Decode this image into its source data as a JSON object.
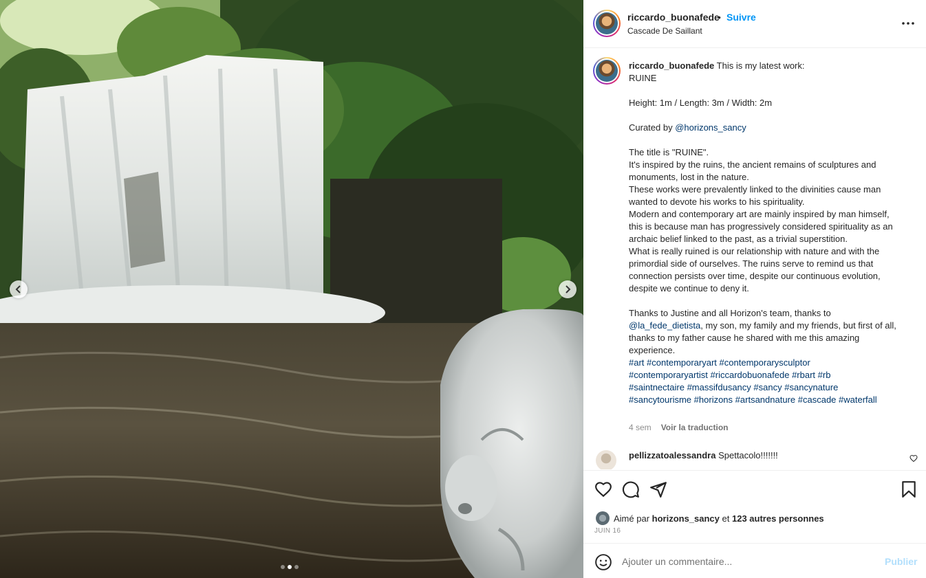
{
  "post": {
    "username": "riccardo_buonafede",
    "separator": "•",
    "follow_label": "Suivre",
    "location": "Cascade De Saillant"
  },
  "caption": {
    "username": "riccardo_buonafede",
    "p1": " This is my latest work:\nRUINE\n\nHeight: 1m / Length: 3m / Width: 2m\n\nCurated by ",
    "mention1": "@horizons_sancy",
    "p2": "\n\nThe title is \"RUINE\".\nIt's inspired by the ruins, the ancient remains of sculptures and monuments, lost in the nature.\nThese works were prevalently linked to the divinities cause man wanted to devote his works to his spirituality.\nModern and contemporary art are mainly inspired by man himself, this is because man has progressively considered spirituality as an archaic belief linked to the past, as a trivial superstition.\nWhat is really ruined is our relationship with nature and with the primordial side of ourselves. The ruins serve to remind us that connection persists over time, despite our continuous evolution, despite we continue to deny it.\n\nThanks to Justine and all Horizon's team, thanks to\n",
    "mention2": "@la_fede_dietista",
    "p3": ", my son, my family and my friends, but first of all, thanks to my father cause he shared with me this amazing experience.\n",
    "hashtags": [
      "#art",
      "#contemporaryart",
      "#contemporarysculptor",
      "#contemporaryartist",
      "#riccardobuonafede",
      "#rbart",
      "#rb",
      "#saintnectaire",
      "#massifdusancy",
      "#sancy",
      "#sancynature",
      "#sancytourisme",
      "#horizons",
      "#artsandnature",
      "#cascade",
      "#waterfall"
    ],
    "time_ago": "4 sem",
    "translate_label": "Voir la traduction"
  },
  "comment": {
    "username": "pellizzatoalessandra",
    "text": "Spettacolo!!!!!!!"
  },
  "likes": {
    "prefix": "Aimé par ",
    "user": "horizons_sancy",
    "middle": " et ",
    "count_text": "123 autres personnes"
  },
  "date": "JUIN 16",
  "compose": {
    "placeholder": "Ajouter un commentaire...",
    "publish_label": "Publier"
  },
  "carousel": {
    "slide_count": 3,
    "active_index": 1
  },
  "icons": {
    "like": "heart-icon",
    "comment": "comment-bubble-icon",
    "share": "paper-plane-icon",
    "save": "bookmark-icon",
    "more": "more-horizontal-icon",
    "emoji": "emoji-icon",
    "prev": "chevron-left-icon",
    "next": "chevron-right-icon"
  },
  "colors": {
    "follow_blue": "#0095f6",
    "link_blue": "#00376b",
    "publish_disabled": "#b2dffc"
  }
}
